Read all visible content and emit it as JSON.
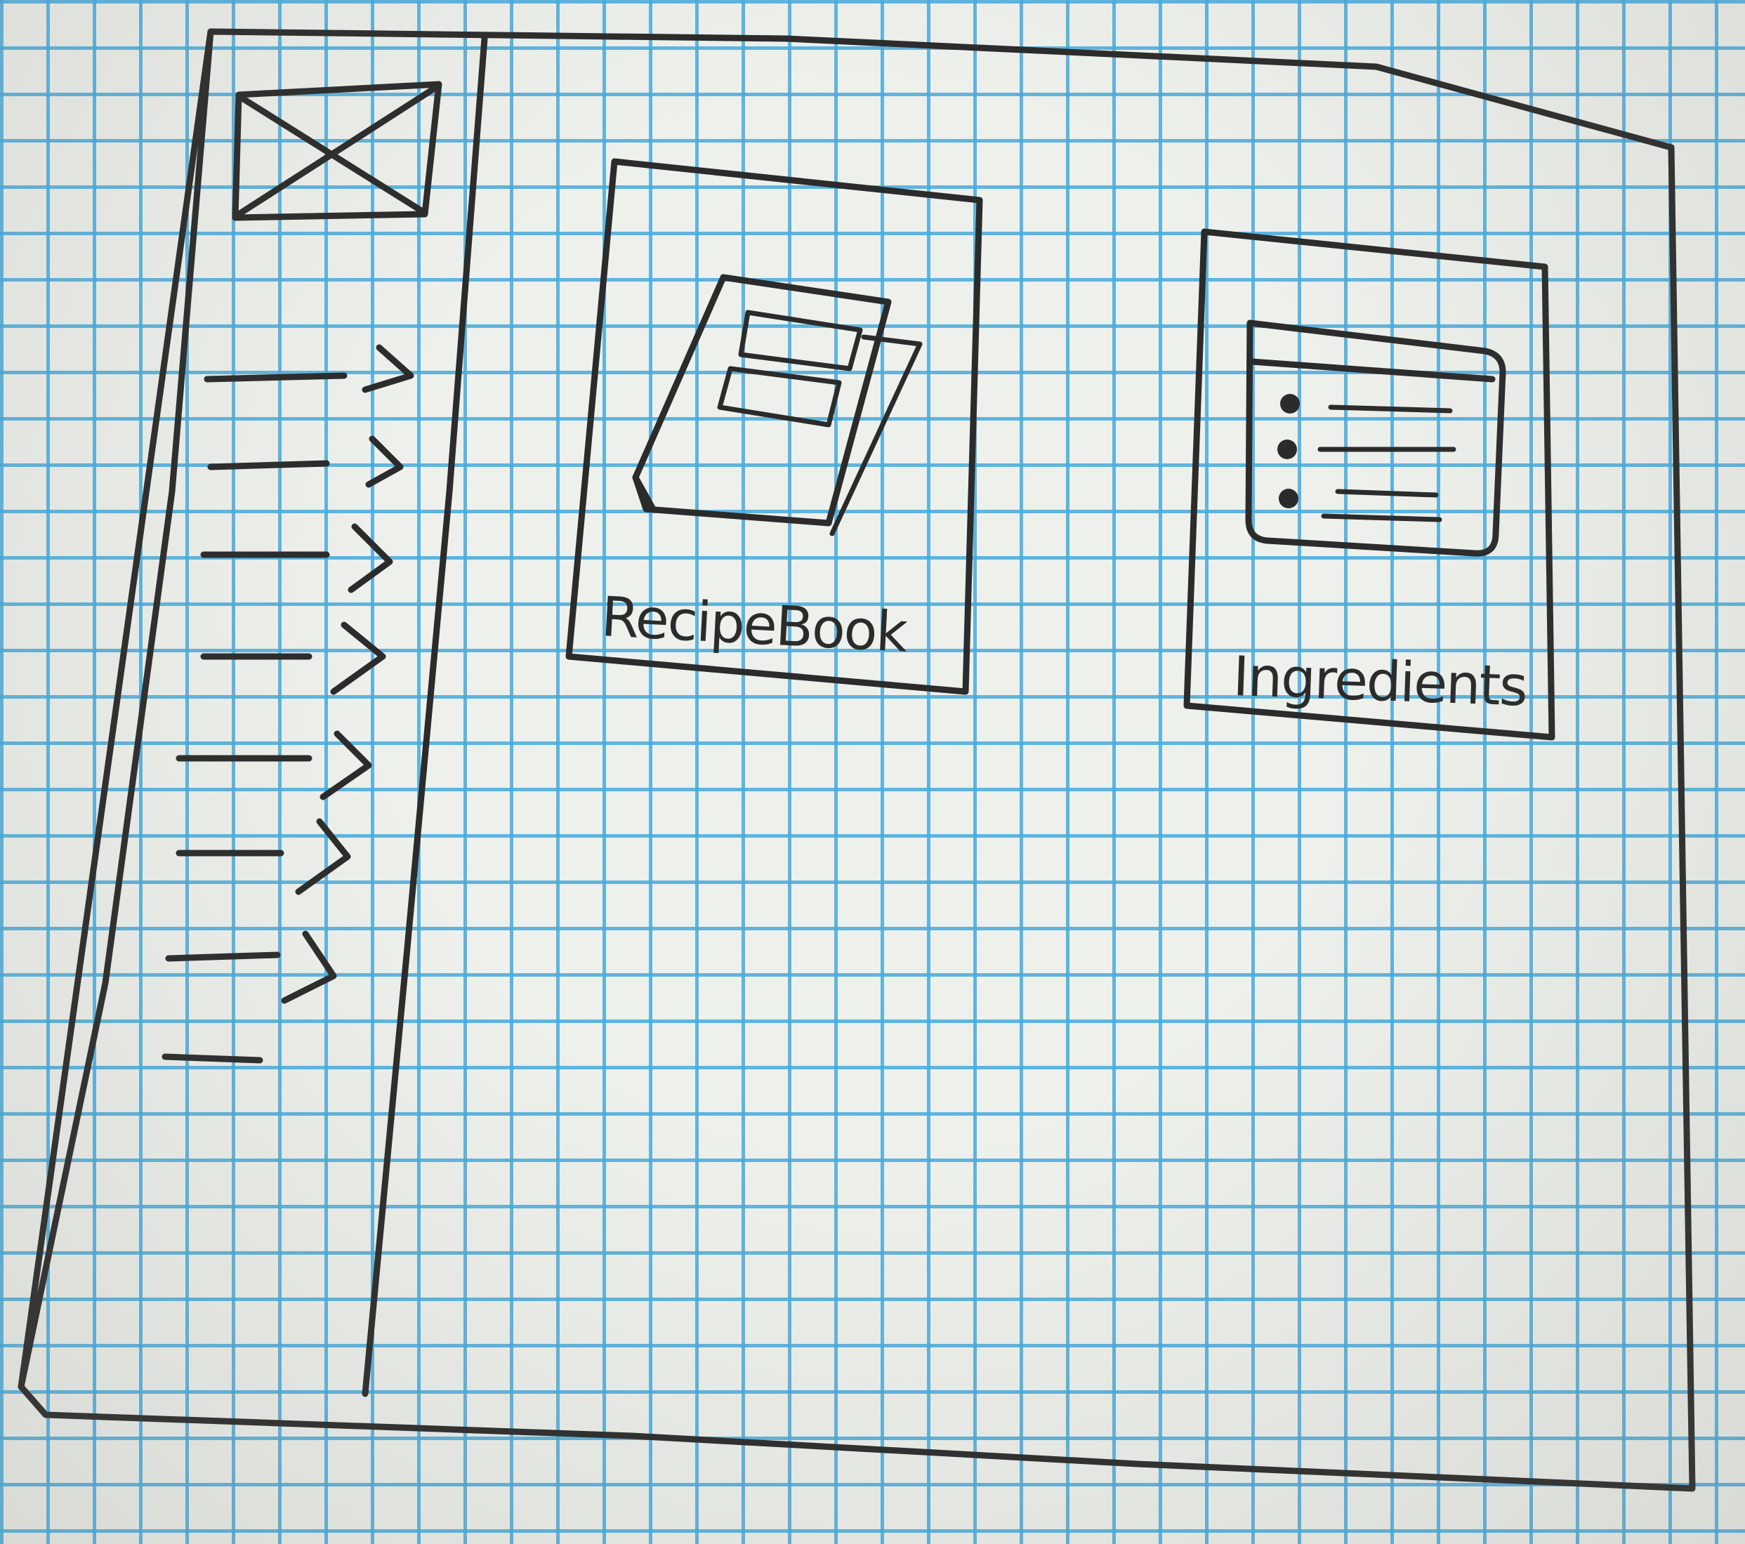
{
  "cards": [
    {
      "label": "RecipeBook",
      "icon": "book-icon"
    },
    {
      "label": "Ingredients",
      "icon": "list-icon"
    }
  ],
  "sidebar": {
    "logo_icon": "image-placeholder-icon",
    "item_count": 8
  },
  "colors": {
    "ink": "#2b2b2b",
    "grid": "#46aadc",
    "paper": "#eef0ec"
  }
}
